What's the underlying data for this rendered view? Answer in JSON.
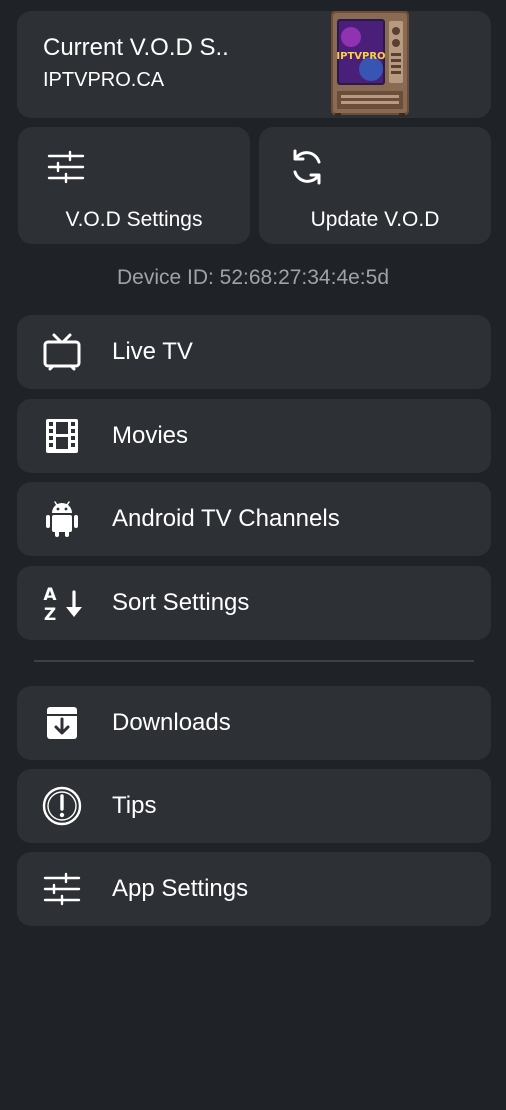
{
  "source": {
    "title": "Current V.O.D S..",
    "subtitle": "IPTVPRO.CA",
    "thumbnail_text": "IPTVPRO"
  },
  "quick_actions": {
    "vod_settings": {
      "label": "V.O.D Settings",
      "icon": "sliders-icon"
    },
    "update_vod": {
      "label": "Update V.O.D",
      "icon": "refresh-icon"
    }
  },
  "device_id": "Device ID: 52:68:27:34:4e:5d",
  "menu": [
    {
      "label": "Live TV",
      "icon": "tv-icon"
    },
    {
      "label": "Movies",
      "icon": "film-icon"
    },
    {
      "label": "Android TV Channels",
      "icon": "android-icon"
    },
    {
      "label": "Sort Settings",
      "icon": "sort-az-icon"
    }
  ],
  "menu_secondary": [
    {
      "label": "Downloads",
      "icon": "download-box-icon"
    },
    {
      "label": "Tips",
      "icon": "alert-circle-icon"
    },
    {
      "label": "App Settings",
      "icon": "sliders-icon"
    }
  ],
  "colors": {
    "background": "#1f2226",
    "card": "#2d3035",
    "text": "#ffffff",
    "muted_text": "#9fa3a8"
  }
}
